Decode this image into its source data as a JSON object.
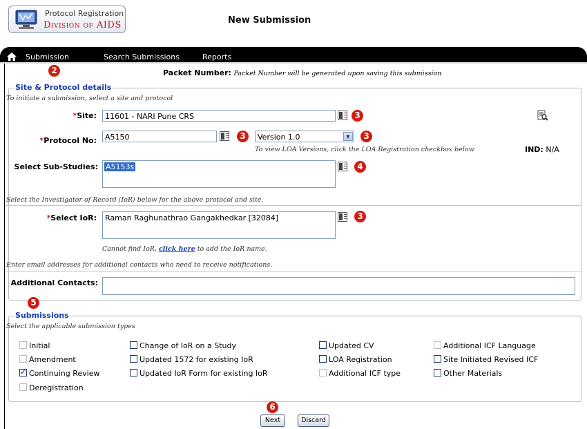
{
  "header": {
    "logo_top": "Protocol Registration",
    "logo_bottom": "Division of AIDS",
    "title": "New Submission"
  },
  "nav": {
    "items": [
      "Submission",
      "Search Submissions",
      "Reports"
    ]
  },
  "packet": {
    "label": "Packet Number:",
    "value": "Packet Number will be generated upon saving this submission"
  },
  "site_protocol": {
    "legend": "Site & Protocol details",
    "intro": "To initiate a submission, select a site and protocol",
    "site_label": "Site:",
    "site_value": "11601 - NARI Pune CRS",
    "protocol_label": "Protocol No:",
    "protocol_value": "A5150",
    "version_value": "Version 1.0",
    "loa_note": "To view LOA Versions, click the LOA Registration checkbox below",
    "ind_label": "IND:",
    "ind_value": "N/A",
    "substudies_label": "Select Sub-Studies:",
    "substudies": [
      "A5153s"
    ],
    "ior_intro": "Select the Investigator of Record (IoR) below for the above protocol and site.",
    "ior_label": "Select IoR:",
    "ior_value": "Raman Raghunathrao Gangakhedkar [32084]",
    "ior_note_prefix": "Cannot find IoR,",
    "ior_note_link": "click here",
    "ior_note_suffix": "to add the IoR name.",
    "contacts_intro": "Enter email addresses for additional contacts who need to receive notifications.",
    "contacts_label": "Additional Contacts:",
    "contacts_value": ""
  },
  "submissions": {
    "legend": "Submissions",
    "intro": "Select the applicable submission types",
    "types": [
      {
        "label": "Initial",
        "checked": false,
        "disabled": true
      },
      {
        "label": "Amendment",
        "checked": false,
        "disabled": true
      },
      {
        "label": "Continuing Review",
        "checked": true,
        "disabled": false
      },
      {
        "label": "Deregistration",
        "checked": false,
        "disabled": true
      },
      {
        "label": "Change of IoR on a Study",
        "checked": false,
        "disabled": false
      },
      {
        "label": "Updated 1572 for existing IoR",
        "checked": false,
        "disabled": false
      },
      {
        "label": "Updated IoR Form for existing IoR",
        "checked": false,
        "disabled": false
      },
      {
        "label": "Updated CV",
        "checked": false,
        "disabled": false
      },
      {
        "label": "LOA Registration",
        "checked": false,
        "disabled": false
      },
      {
        "label": "Additional ICF type",
        "checked": false,
        "disabled": true
      },
      {
        "label": "Additional ICF Language",
        "checked": false,
        "disabled": true
      },
      {
        "label": "Site Initiated Revised ICF",
        "checked": false,
        "disabled": false
      },
      {
        "label": "Other Materials",
        "checked": false,
        "disabled": false
      }
    ]
  },
  "buttons": {
    "next": "Next",
    "discard": "Discard"
  },
  "annotations": [
    "2",
    "3",
    "3",
    "3",
    "4",
    "3",
    "5",
    "6"
  ],
  "colors": {
    "accent": "#1a3da8",
    "badge": "#d11c12",
    "nav": "#000000"
  }
}
